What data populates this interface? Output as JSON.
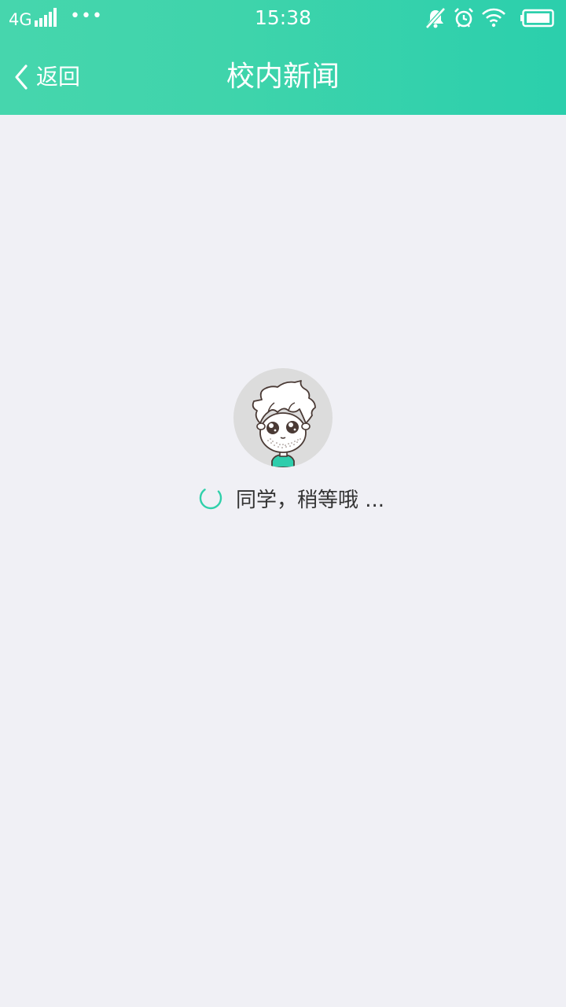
{
  "status_bar": {
    "network": "4G",
    "more": "•••",
    "time": "15:38",
    "icons": [
      "signal-icon",
      "notifications-off-icon",
      "alarm-icon",
      "wifi-icon",
      "battery-icon"
    ]
  },
  "nav": {
    "back_label": "返回",
    "title": "校内新闻"
  },
  "loading": {
    "text": "同学，稍等哦 ..."
  },
  "colors": {
    "accent": "#2fd0aa",
    "background": "#f0f0f5",
    "text": "#333333"
  }
}
